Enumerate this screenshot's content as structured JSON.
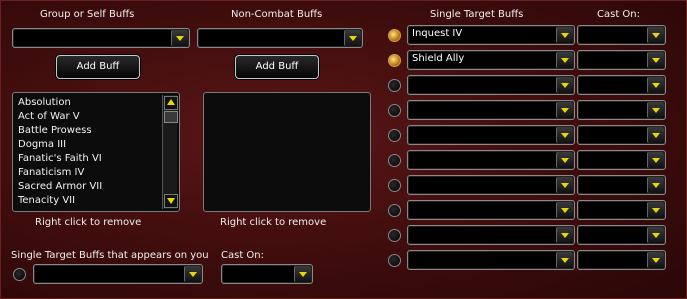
{
  "group_buffs": {
    "header": "Group or Self Buffs",
    "select_value": "",
    "add_button": "Add Buff",
    "items": [
      "Absolution",
      "Act of War V",
      "Battle Prowess",
      "Dogma III",
      "Fanatic's Faith VI",
      "Fanaticism IV",
      "Sacred Armor VII",
      "Tenacity VII"
    ],
    "hint": "Right click to remove"
  },
  "noncombat_buffs": {
    "header": "Non-Combat Buffs",
    "select_value": "",
    "add_button": "Add Buff",
    "hint": "Right click to remove"
  },
  "single_target": {
    "header": "Single Target Buffs",
    "cast_on_header": "Cast On:",
    "rows": [
      {
        "buff": "Inquest IV",
        "cast_on": "",
        "selected": true
      },
      {
        "buff": "Shield Ally",
        "cast_on": "",
        "selected": true
      },
      {
        "buff": "",
        "cast_on": "",
        "selected": false
      },
      {
        "buff": "",
        "cast_on": "",
        "selected": false
      },
      {
        "buff": "",
        "cast_on": "",
        "selected": false
      },
      {
        "buff": "",
        "cast_on": "",
        "selected": false
      },
      {
        "buff": "",
        "cast_on": "",
        "selected": false
      },
      {
        "buff": "",
        "cast_on": "",
        "selected": false
      },
      {
        "buff": "",
        "cast_on": "",
        "selected": false
      },
      {
        "buff": "",
        "cast_on": "",
        "selected": false
      }
    ]
  },
  "appears_on_you": {
    "label": "Single Target Buffs that appears on you",
    "select_value": "",
    "cast_on_label": "Cast On:",
    "cast_on_value": ""
  }
}
